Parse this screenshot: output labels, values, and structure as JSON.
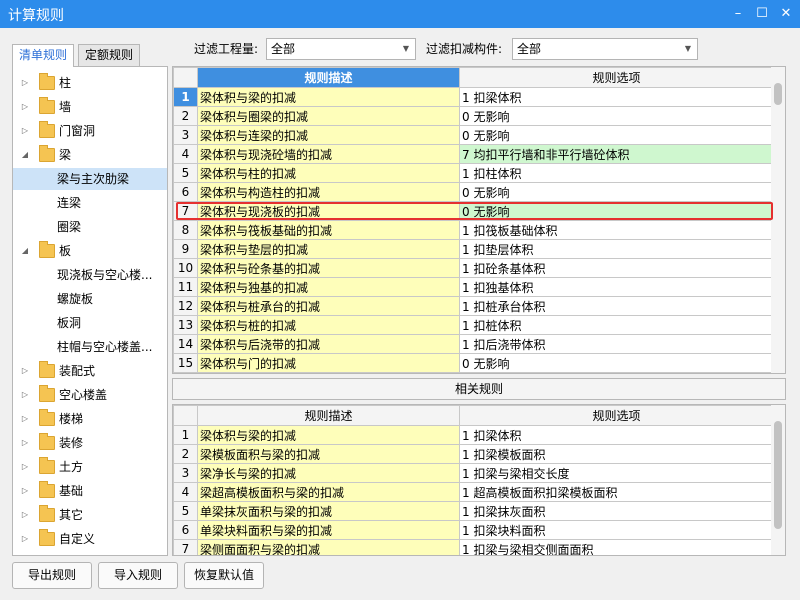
{
  "window": {
    "title": "计算规则",
    "minimize": "–",
    "maximize": "☐",
    "close": "✕"
  },
  "tabs": [
    "清单规则",
    "定额规则"
  ],
  "filters": {
    "project_label": "过滤工程量:",
    "project_value": "全部",
    "component_label": "过滤扣减构件:",
    "component_value": "全部"
  },
  "tree": [
    {
      "label": "柱",
      "level": 0,
      "expand": "▷",
      "folder": true
    },
    {
      "label": "墙",
      "level": 0,
      "expand": "▷",
      "folder": true
    },
    {
      "label": "门窗洞",
      "level": 0,
      "expand": "▷",
      "folder": true
    },
    {
      "label": "梁",
      "level": 0,
      "expand": "◢",
      "folder": true
    },
    {
      "label": "梁与主次肋梁",
      "level": 1,
      "selected": true
    },
    {
      "label": "连梁",
      "level": 1
    },
    {
      "label": "圈梁",
      "level": 1
    },
    {
      "label": "板",
      "level": 0,
      "expand": "◢",
      "folder": true
    },
    {
      "label": "现浇板与空心楼...",
      "level": 1
    },
    {
      "label": "螺旋板",
      "level": 1
    },
    {
      "label": "板洞",
      "level": 1
    },
    {
      "label": "柱帽与空心楼盖...",
      "level": 1
    },
    {
      "label": "装配式",
      "level": 0,
      "expand": "▷",
      "folder": true
    },
    {
      "label": "空心楼盖",
      "level": 0,
      "expand": "▷",
      "folder": true
    },
    {
      "label": "楼梯",
      "level": 0,
      "expand": "▷",
      "folder": true
    },
    {
      "label": "装修",
      "level": 0,
      "expand": "▷",
      "folder": true
    },
    {
      "label": "土方",
      "level": 0,
      "expand": "▷",
      "folder": true
    },
    {
      "label": "基础",
      "level": 0,
      "expand": "▷",
      "folder": true
    },
    {
      "label": "其它",
      "level": 0,
      "expand": "▷",
      "folder": true
    },
    {
      "label": "自定义",
      "level": 0,
      "expand": "▷",
      "folder": true
    }
  ],
  "main_table": {
    "headers": [
      "规则描述",
      "规则选项"
    ],
    "rows": [
      {
        "num": "1",
        "desc": "梁体积与梁的扣减",
        "opt": "1  扣梁体积"
      },
      {
        "num": "2",
        "desc": "梁体积与圈梁的扣减",
        "opt": "0   无影响"
      },
      {
        "num": "3",
        "desc": "梁体积与连梁的扣减",
        "opt": "0   无影响"
      },
      {
        "num": "4",
        "desc": "梁体积与现浇砼墙的扣减",
        "opt": "7  均扣平行墙和非平行墙砼体积",
        "green": true
      },
      {
        "num": "5",
        "desc": "梁体积与柱的扣减",
        "opt": "1  扣柱体积"
      },
      {
        "num": "6",
        "desc": "梁体积与构造柱的扣减",
        "opt": "0   无影响"
      },
      {
        "num": "7",
        "desc": "梁体积与现浇板的扣减",
        "opt": "0   无影响",
        "green": true
      },
      {
        "num": "8",
        "desc": "梁体积与筏板基础的扣减",
        "opt": "1  扣筏板基础体积"
      },
      {
        "num": "9",
        "desc": "梁体积与垫层的扣减",
        "opt": "1  扣垫层体积"
      },
      {
        "num": "10",
        "desc": "梁体积与砼条基的扣减",
        "opt": "1  扣砼条基体积"
      },
      {
        "num": "11",
        "desc": "梁体积与独基的扣减",
        "opt": "1  扣独基体积"
      },
      {
        "num": "12",
        "desc": "梁体积与桩承台的扣减",
        "opt": "1  扣桩承台体积"
      },
      {
        "num": "13",
        "desc": "梁体积与桩的扣减",
        "opt": "1  扣桩体积"
      },
      {
        "num": "14",
        "desc": "梁体积与后浇带的扣减",
        "opt": "1  扣后浇带体积"
      },
      {
        "num": "15",
        "desc": "梁体积与门的扣减",
        "opt": "0   无影响"
      }
    ]
  },
  "related": {
    "title": "相关规则",
    "headers": [
      "规则描述",
      "规则选项"
    ],
    "rows": [
      {
        "num": "1",
        "desc": "梁体积与梁的扣减",
        "opt": "1  扣梁体积"
      },
      {
        "num": "2",
        "desc": "梁模板面积与梁的扣减",
        "opt": "1  扣梁模板面积"
      },
      {
        "num": "3",
        "desc": "梁净长与梁的扣减",
        "opt": "1  扣梁与梁相交长度"
      },
      {
        "num": "4",
        "desc": "梁超高模板面积与梁的扣减",
        "opt": "1  超高模板面积扣梁模板面积"
      },
      {
        "num": "5",
        "desc": "单梁抹灰面积与梁的扣减",
        "opt": "1  扣梁抹灰面积"
      },
      {
        "num": "6",
        "desc": "单梁块料面积与梁的扣减",
        "opt": "1  扣梁块料面积"
      },
      {
        "num": "7",
        "desc": "梁侧面面积与梁的扣减",
        "opt": "1  扣梁与梁相交侧面面积"
      }
    ]
  },
  "buttons": {
    "export": "导出规则",
    "import": "导入规则",
    "restore": "恢复默认值"
  },
  "colors": {
    "titlebar": "#2d8ceb",
    "highlight_border": "#e53030",
    "selected_cell": "#3f8fe0",
    "desc_cell": "#fefeba",
    "green_cell": "#cff7cf"
  }
}
